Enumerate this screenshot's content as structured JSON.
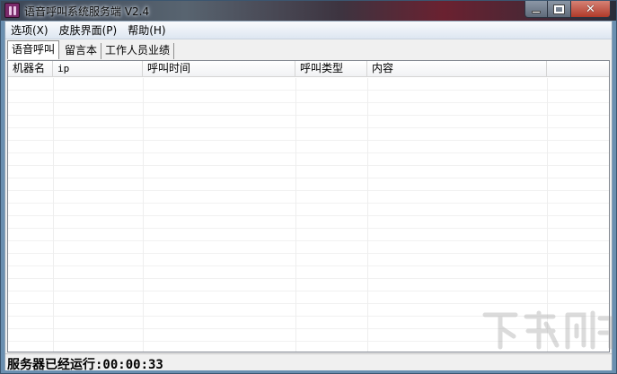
{
  "window": {
    "title": "语音呼叫系统服务端 V2.4",
    "buttons": {
      "minimize_icon": "minimize-icon",
      "maximize_icon": "maximize-icon",
      "close_icon": "close-icon",
      "close_glyph": "✕"
    }
  },
  "menubar": {
    "items": [
      {
        "label": "选项(X)"
      },
      {
        "label": "皮肤界面(P)"
      },
      {
        "label": "帮助(H)"
      }
    ]
  },
  "tabs": [
    {
      "label": "语音呼叫",
      "active": true
    },
    {
      "label": "留言本",
      "active": false
    },
    {
      "label": "工作人员业绩",
      "active": false
    }
  ],
  "table": {
    "columns": [
      {
        "label": "机器名"
      },
      {
        "label": "ip"
      },
      {
        "label": "呼叫时间"
      },
      {
        "label": "呼叫类型"
      },
      {
        "label": "内容"
      }
    ],
    "rows": []
  },
  "status": {
    "text": "服务器已经运行:00:00:33"
  },
  "colors": {
    "titlebar_accent": "#6a2130",
    "close_button": "#b03a2a",
    "menubar": "#dde6f1",
    "window_border": "#6a8fb0"
  }
}
